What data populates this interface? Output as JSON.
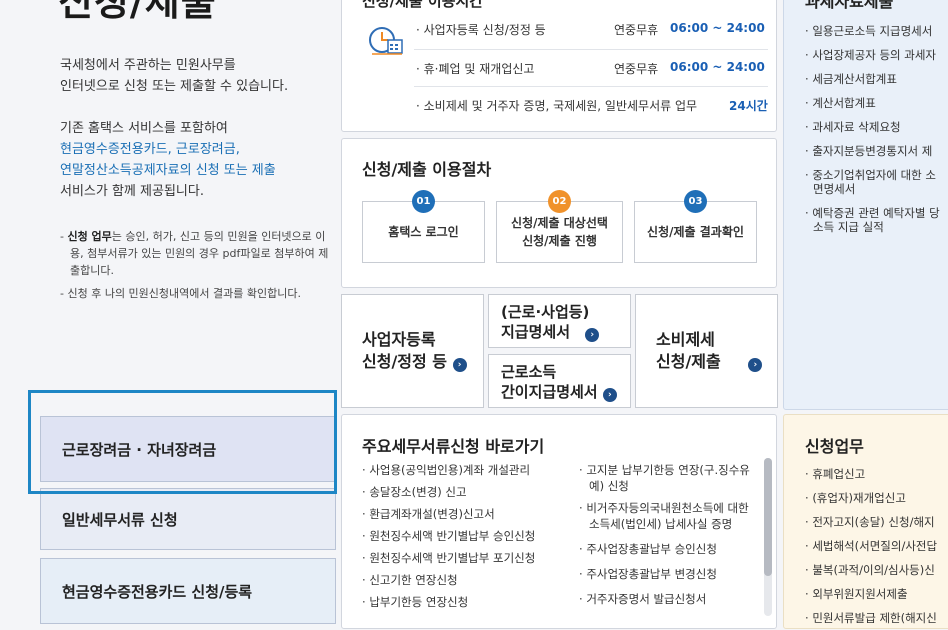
{
  "title": "신청/제출",
  "intro": {
    "line1": "국세청에서 주관하는 민원사무를",
    "line2": "인터넷으로 신청 또는 제출할 수 있습니다.",
    "line3": "기존 홈택스 서비스를 포함하여",
    "line4": "현금영수증전용카드, 근로장려금,",
    "line5": "연말정산소득공제자료의 신청 또는 제출",
    "line6": "서비스가 함께 제공됩니다."
  },
  "notes": {
    "n1_bold": "신청 업무",
    "n1_rest": "는 승인, 허가, 신고 등의 민원을 인터넷으로 이용, 첨부서류가 있는 민원의 경우 pdf파일로 첨부하여 제출합니다.",
    "n2": "신청 후 나의 민원신청내역에서 결과를 확인합니다."
  },
  "left_buttons": [
    "근로장려금 · 자녀장려금",
    "일반세무서류 신청",
    "현금영수증전용카드 신청/등록"
  ],
  "schedule": {
    "title": "신청/제출 이용시간",
    "rows": [
      {
        "label": "사업자등록 신청/정정 등",
        "days": "연중무휴",
        "time": "06:00 ~ 24:00"
      },
      {
        "label": "휴·폐업 및 재개업신고",
        "days": "연중무휴",
        "time": "06:00 ~ 24:00"
      },
      {
        "label": "소비제세 및 거주자 증명, 국제세원, 일반세무서류 업무",
        "days": "",
        "time": "24시간"
      }
    ]
  },
  "procedure": {
    "title": "신청/제출 이용절차",
    "steps": [
      {
        "num": "01",
        "line1": "홈택스 로그인",
        "line2": "",
        "color": "#1f6fb8"
      },
      {
        "num": "02",
        "line1": "신청/제출 대상선택",
        "line2": "신청/제출 진행",
        "color": "#f0922b"
      },
      {
        "num": "03",
        "line1": "신청/제출 결과확인",
        "line2": "",
        "color": "#1f6fb8"
      }
    ]
  },
  "quick": {
    "b1_l1": "사업자등록",
    "b1_l2": "신청/정정 등",
    "b2_l1": "(근로·사업등)",
    "b2_l2": "지급명세서",
    "b3_l1": "근로소득",
    "b3_l2": "간이지급명세서",
    "b4_l1": "소비제세",
    "b4_l2": "신청/제출",
    "arrow": "›"
  },
  "shortcuts": {
    "title": "주요세무서류신청 바로가기",
    "col1": [
      "사업용(공익법인용)계좌 개설관리",
      "송달장소(변경) 신고",
      "환급계좌개설(변경)신고서",
      "원천징수세액 반기별납부 승인신청",
      "원천징수세액 반기별납부 포기신청",
      "신고기한 연장신청",
      "납부기한등 연장신청"
    ],
    "col2": [
      "고지분 납부기한등 연장(구.징수유예) 신청",
      "비거주자등의국내원천소득에 대한 소득세(법인세) 납세사실 증명",
      "주사업장총괄납부 승인신청",
      "주사업장총괄납부 변경신청",
      "거주자증명서 발급신청서"
    ]
  },
  "right_top": {
    "title": "과세자료제출",
    "items": [
      "일용근로소득 지급명세서",
      "사업장제공자 등의 과세자",
      "세금계산서합계표",
      "계산서합계표",
      "과세자료 삭제요청",
      "출자지분등변경통지서 제",
      "중소기업취업자에 대한 소 면명세서",
      "예탁증권 관련 예탁자별 당소득 지급 실적"
    ]
  },
  "right_bottom": {
    "title": "신청업무",
    "items": [
      "휴폐업신고",
      "(휴업자)재개업신고",
      "전자고지(송달) 신청/해지",
      "세법해석(서면질의/사전답",
      "불복(과적/이의/심사등)신",
      "외부위원지원서제출",
      "민원서류발급 제한(해지신"
    ]
  }
}
